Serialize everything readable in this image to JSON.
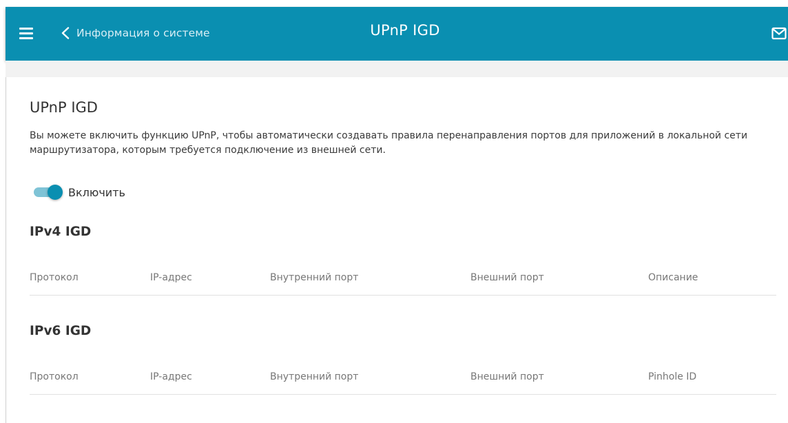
{
  "header": {
    "back_label": "Информация о системе",
    "title": "UPnP IGD",
    "menu_icon": "menu-icon",
    "back_icon": "chevron-left-icon",
    "mail_icon": "mail-icon",
    "accent_color": "#0a8fb1"
  },
  "main": {
    "title": "UPnP IGD",
    "description": "Вы можете включить функцию UPnP, чтобы автоматически создавать правила перенаправления портов для приложений в локальной сети маршрутизатора, которым требуется подключение из внешней сети.",
    "toggle": {
      "label": "Включить",
      "checked": true
    }
  },
  "ipv4": {
    "title": "IPv4 IGD",
    "columns": [
      "Протокол",
      "IP-адрес",
      "Внутренний порт",
      "Внешний порт",
      "Описание"
    ]
  },
  "ipv6": {
    "title": "IPv6 IGD",
    "columns": [
      "Протокол",
      "IP-адрес",
      "Внутренний порт",
      "Внешний порт",
      "Pinhole ID"
    ]
  }
}
